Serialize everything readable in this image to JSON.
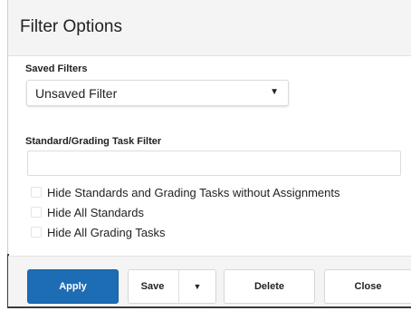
{
  "dialog": {
    "title": "Filter Options"
  },
  "saved_filters": {
    "label": "Saved Filters",
    "selected": "Unsaved Filter",
    "caret_glyph": "▼"
  },
  "standard_filter": {
    "label": "Standard/Grading Task Filter",
    "value": "",
    "placeholder": ""
  },
  "options": [
    {
      "label": "Hide Standards and Grading Tasks without Assignments",
      "checked": false
    },
    {
      "label": "Hide All Standards",
      "checked": false
    },
    {
      "label": "Hide All Grading Tasks",
      "checked": false
    }
  ],
  "footer": {
    "apply_label": "Apply",
    "save_label": "Save",
    "save_caret_glyph": "▼",
    "delete_label": "Delete",
    "close_label": "Close"
  },
  "colors": {
    "primary": "#1d6db5",
    "header_bg": "#f4f4f4"
  }
}
